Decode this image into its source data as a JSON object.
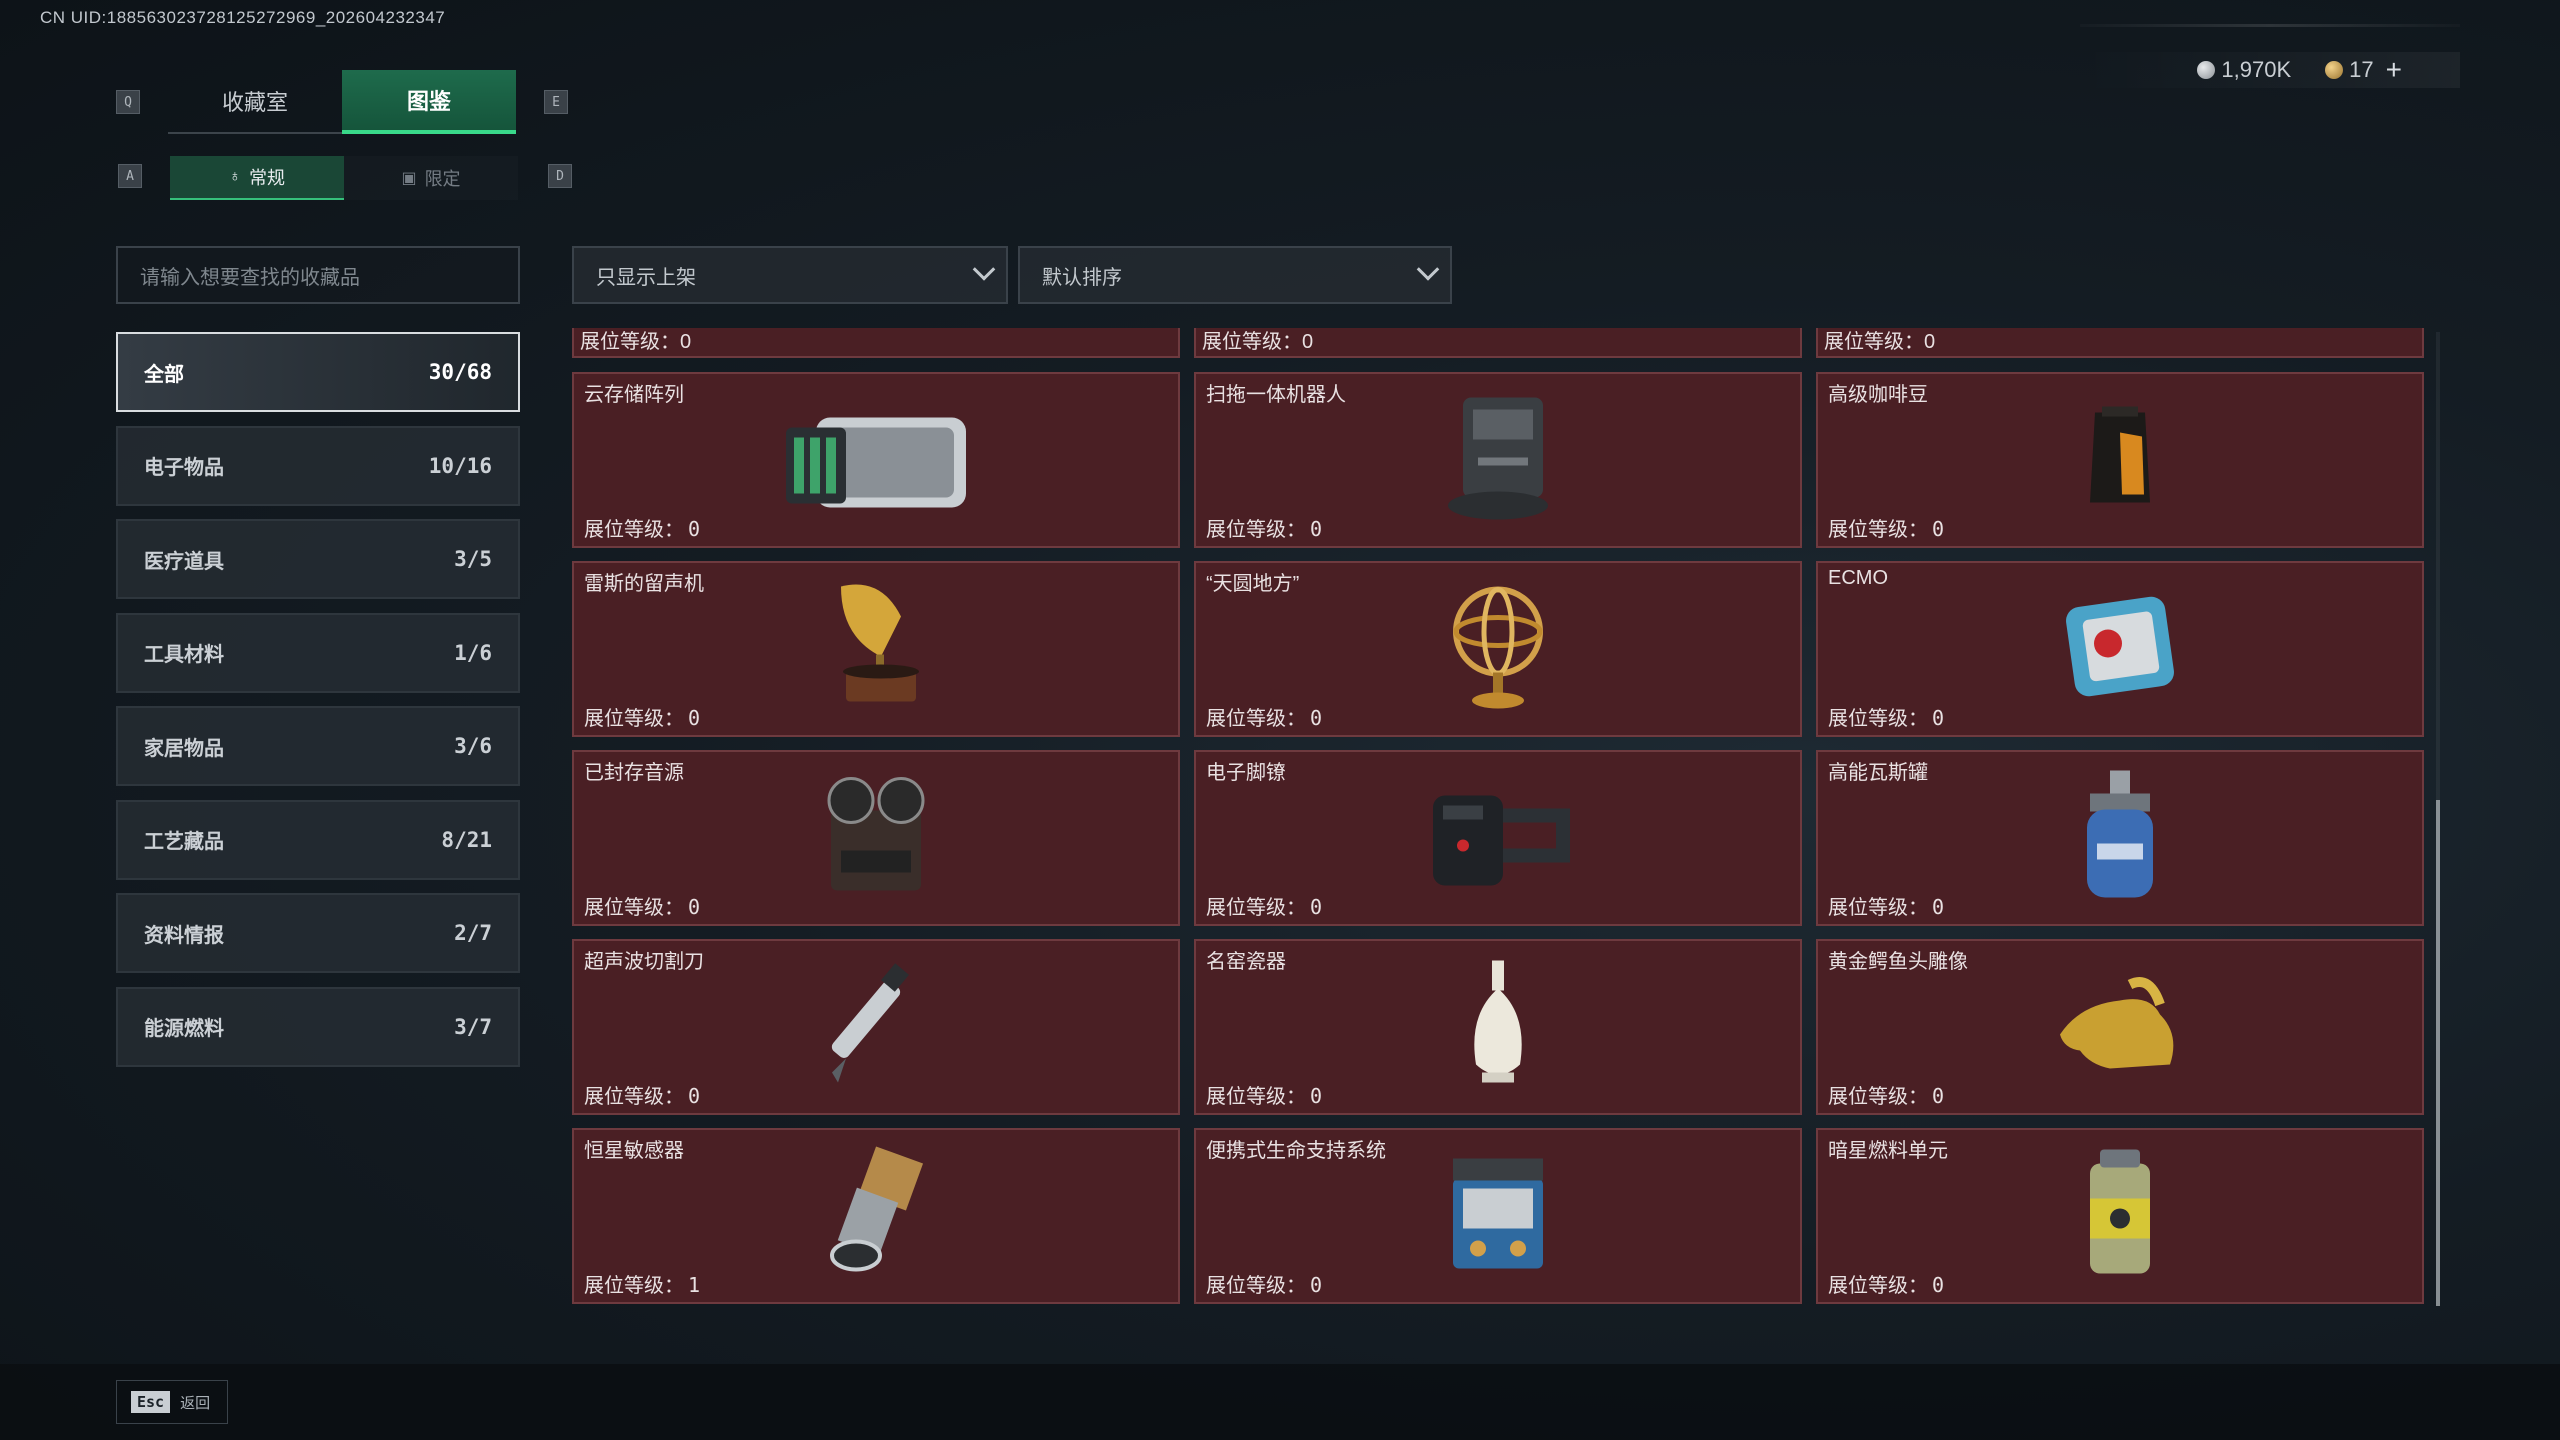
{
  "uid_text": "CN UID:18856302372812527296​9_202604232347",
  "currency": {
    "silver": "1,970K",
    "gold": "17",
    "plus": "+"
  },
  "keys": {
    "q": "Q",
    "e": "E",
    "a": "A",
    "d": "D",
    "esc": "Esc"
  },
  "tabs": {
    "collection": "收藏室",
    "catalog": "图鉴"
  },
  "subtabs": {
    "regular": "常规",
    "limited": "限定"
  },
  "search_placeholder": "请输入想要查找的收藏品",
  "filter_show": "只显示上架",
  "sort_default": "默认排序",
  "categories": [
    {
      "label": "全部",
      "count": "30/68"
    },
    {
      "label": "电子物品",
      "count": "10/16"
    },
    {
      "label": "医疗道具",
      "count": "3/5"
    },
    {
      "label": "工具材料",
      "count": "1/6"
    },
    {
      "label": "家居物品",
      "count": "3/6"
    },
    {
      "label": "工艺藏品",
      "count": "8/21"
    },
    {
      "label": "资料情报",
      "count": "2/7"
    },
    {
      "label": "能源燃料",
      "count": "3/7"
    }
  ],
  "level_label": "展位等级：",
  "top_partial_levels": [
    "0",
    "0",
    "0"
  ],
  "items": [
    {
      "name": "云存储阵列",
      "level": "0",
      "icon": "server-icon"
    },
    {
      "name": "扫拖一体机器人",
      "level": "0",
      "icon": "robot-vacuum-icon"
    },
    {
      "name": "高级咖啡豆",
      "level": "0",
      "icon": "coffee-bag-icon"
    },
    {
      "name": "雷斯的留声机",
      "level": "0",
      "icon": "gramophone-icon"
    },
    {
      "name": "“天圆地方”",
      "level": "0",
      "icon": "armillary-sphere-icon"
    },
    {
      "name": "ECMO",
      "level": "0",
      "icon": "ecmo-machine-icon"
    },
    {
      "name": "已封存音源",
      "level": "0",
      "icon": "reel-tape-icon"
    },
    {
      "name": "电子脚镣",
      "level": "0",
      "icon": "ankle-monitor-icon"
    },
    {
      "name": "高能瓦斯罐",
      "level": "0",
      "icon": "gas-canister-icon"
    },
    {
      "name": "超声波切割刀",
      "level": "0",
      "icon": "ultrasonic-knife-icon"
    },
    {
      "name": "名窑瓷器",
      "level": "0",
      "icon": "porcelain-vase-icon"
    },
    {
      "name": "黄金鳄鱼头雕像",
      "level": "0",
      "icon": "gold-croc-statue-icon"
    },
    {
      "name": "恒星敏感器",
      "level": "1",
      "icon": "star-sensor-icon"
    },
    {
      "name": "便携式生命支持系统",
      "level": "0",
      "icon": "life-support-icon"
    },
    {
      "name": "暗星燃料单元",
      "level": "0",
      "icon": "fuel-cell-icon"
    }
  ],
  "back_label": "返回"
}
